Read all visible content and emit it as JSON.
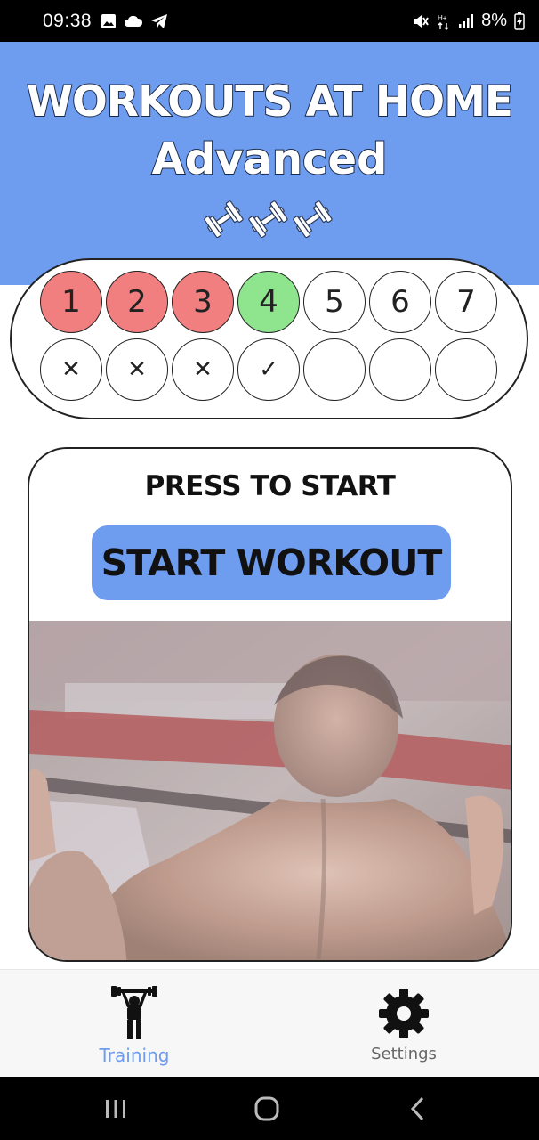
{
  "status_bar": {
    "time": "09:38",
    "battery": "8%",
    "icons": [
      "image-icon",
      "cloud-icon",
      "telegram-icon",
      "mute-icon",
      "network-icon",
      "signal-icon",
      "battery-icon"
    ]
  },
  "header": {
    "title": "WORKOUTS AT HOME",
    "subtitle": "Advanced",
    "icon": "dumbbell-icon",
    "background": "#6e9cee"
  },
  "days": [
    {
      "number": "1",
      "state": "done",
      "mark": "✕"
    },
    {
      "number": "2",
      "state": "done",
      "mark": "✕"
    },
    {
      "number": "3",
      "state": "done",
      "mark": "✕"
    },
    {
      "number": "4",
      "state": "today",
      "mark": "✓"
    },
    {
      "number": "5",
      "state": "pending",
      "mark": ""
    },
    {
      "number": "6",
      "state": "pending",
      "mark": ""
    },
    {
      "number": "7",
      "state": "pending",
      "mark": ""
    }
  ],
  "colors": {
    "accent": "#6e9cee",
    "done": "#f27f7f",
    "today": "#8ee58e"
  },
  "card": {
    "press_label": "PRESS TO START",
    "start_button_label": "START WORKOUT"
  },
  "bottom_nav": {
    "items": [
      {
        "label": "Training",
        "icon": "weightlifter-icon",
        "active": true
      },
      {
        "label": "Settings",
        "icon": "gear-icon",
        "active": false
      }
    ]
  },
  "system_nav": {
    "buttons": [
      "recent-apps-icon",
      "home-icon",
      "back-icon"
    ]
  }
}
